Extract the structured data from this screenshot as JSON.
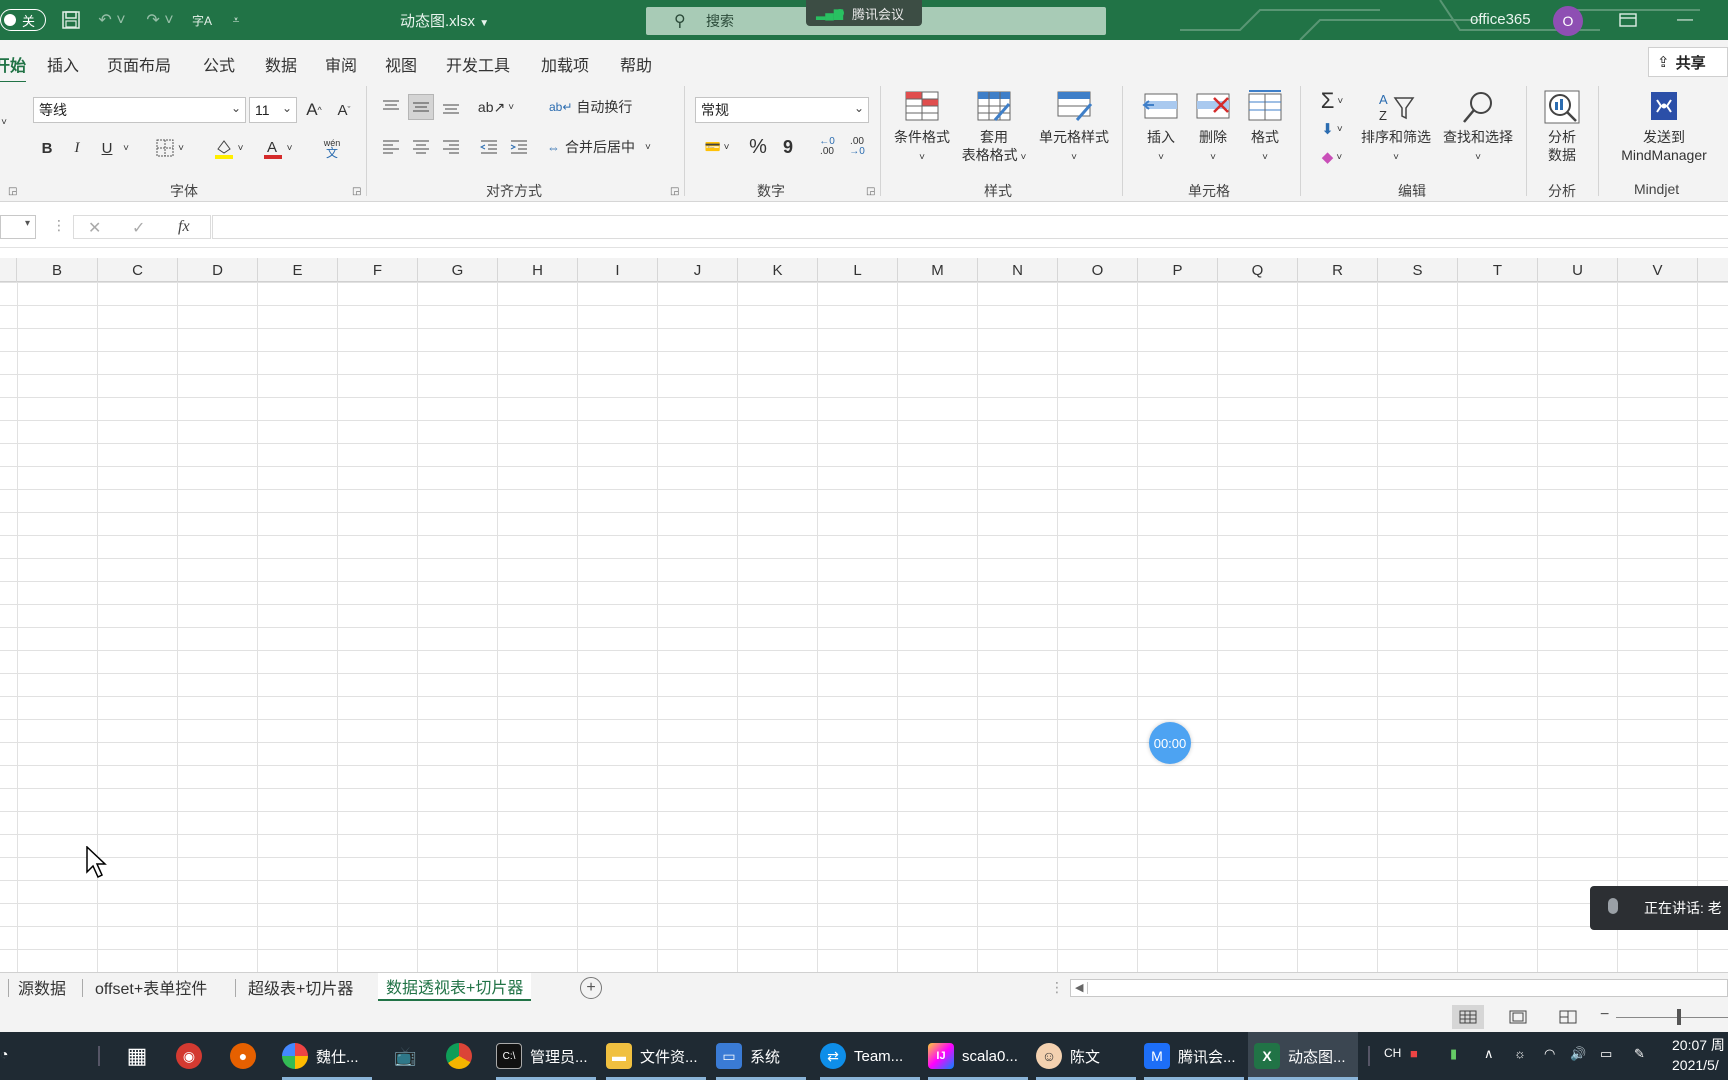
{
  "titlebar": {
    "autosave_label": "关",
    "filename": "动态图.xlsx",
    "search_placeholder": "搜索",
    "meeting_badge": "腾讯会议",
    "user": "office365",
    "avatar_initial": "O"
  },
  "ribbon_tabs": [
    "开始",
    "插入",
    "页面布局",
    "公式",
    "数据",
    "审阅",
    "视图",
    "开发工具",
    "加载项",
    "帮助"
  ],
  "share_label": "共享",
  "font": {
    "name": "等线",
    "size": "11",
    "group_label": "字体",
    "grow": "A",
    "shrink": "A",
    "bold": "B",
    "italic": "I",
    "underline": "U",
    "phonetic_top": "wén",
    "phonetic_bottom": "文"
  },
  "alignment": {
    "wrap_text": "自动换行",
    "merge_center": "合并后居中",
    "group_label": "对齐方式"
  },
  "number": {
    "format": "常规",
    "percent": "%",
    "comma": "9",
    "inc_decimal": ".00",
    "dec_decimal": ".00",
    "group_label": "数字"
  },
  "styles": {
    "conditional": "条件格式",
    "table_format_1": "套用",
    "table_format_2": "表格格式",
    "cell_styles": "单元格样式",
    "group_label": "样式"
  },
  "cells_group": {
    "insert": "插入",
    "delete": "删除",
    "format": "格式",
    "group_label": "单元格"
  },
  "editing": {
    "sort_filter": "排序和筛选",
    "find_select": "查找和选择",
    "group_label": "编辑"
  },
  "analysis": {
    "analyze_1": "分析",
    "analyze_2": "数据",
    "group_label": "分析"
  },
  "mindjet": {
    "send_1": "发送到",
    "send_2": "MindManager",
    "group_label": "Mindjet"
  },
  "formula_bar": {
    "cancel": "✕",
    "enter": "✓",
    "fx": "fx",
    "value": ""
  },
  "columns": [
    "B",
    "C",
    "D",
    "E",
    "F",
    "G",
    "H",
    "I",
    "J",
    "K",
    "L",
    "M",
    "N",
    "O",
    "P",
    "Q",
    "R",
    "S",
    "T",
    "U",
    "V"
  ],
  "sheets": [
    "源数据",
    "offset+表单控件",
    "超级表+切片器",
    "数据透视表+切片器"
  ],
  "active_sheet": "数据透视表+切片器",
  "overlays": {
    "timer": "00:00",
    "speaking": "正在讲话: 老"
  },
  "taskbar": {
    "items": [
      "魏仕...",
      "管理员...",
      "文件资...",
      "系统",
      "Team...",
      "scala0...",
      "陈文",
      "腾讯会...",
      "动态图..."
    ],
    "lang": "CH",
    "time": "20:07 周",
    "date": "2021/5/"
  },
  "colors": {
    "excel_green": "#217346",
    "ribbon_bg": "#f3f3f3",
    "taskbar_bg": "#1f2a33",
    "timer_blue": "#4da3f2"
  }
}
